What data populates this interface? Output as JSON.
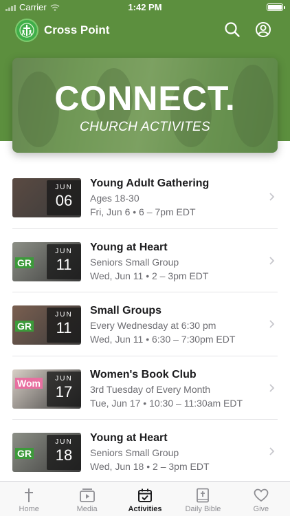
{
  "status": {
    "carrier": "Carrier",
    "time": "1:42 PM"
  },
  "header": {
    "app_title": "Cross Point",
    "search_icon": "search-icon",
    "account_icon": "account-icon"
  },
  "hero": {
    "title": "CONNECT.",
    "subtitle": "CHURCH ACTIVITES"
  },
  "events": [
    {
      "title": "Young Adult Gathering",
      "subtitle": "Ages 18-30",
      "when": "Fri, Jun 6 • 6 – 7pm EDT",
      "month": "JUN",
      "day": "06",
      "thumb_color": "#5a4a42"
    },
    {
      "title": "Young at Heart",
      "subtitle": "Seniors Small Group",
      "when": "Wed, Jun 11 • 2 – 3pm EDT",
      "month": "JUN",
      "day": "11",
      "thumb_color": "#8c8f86"
    },
    {
      "title": "Small Groups",
      "subtitle": "Every Wednesday at 6:30 pm",
      "when": "Wed, Jun 11 • 6:30 – 7:30pm EDT",
      "month": "JUN",
      "day": "11",
      "thumb_color": "#7a5f50"
    },
    {
      "title": "Women's Book Club",
      "subtitle": "3rd Tuesday of Every Month",
      "when": "Tue, Jun 17 • 10:30 – 11:30am EDT",
      "month": "JUN",
      "day": "17",
      "thumb_color": "#d8cfc6"
    },
    {
      "title": "Young at Heart",
      "subtitle": "Seniors Small Group",
      "when": "Wed, Jun 18 • 2 – 3pm EDT",
      "month": "JUN",
      "day": "18",
      "thumb_color": "#8c8f86"
    }
  ],
  "tabs": [
    {
      "label": "Home",
      "icon": "cross-icon",
      "active": false
    },
    {
      "label": "Media",
      "icon": "media-icon",
      "active": false
    },
    {
      "label": "Activities",
      "icon": "calendar-icon",
      "active": true
    },
    {
      "label": "Daily Bible",
      "icon": "bible-icon",
      "active": false
    },
    {
      "label": "Give",
      "icon": "heart-icon",
      "active": false
    }
  ],
  "colors": {
    "brand_green": "#5c8f3e",
    "text_primary": "#1c1c1e",
    "text_secondary": "#6e6e73"
  }
}
